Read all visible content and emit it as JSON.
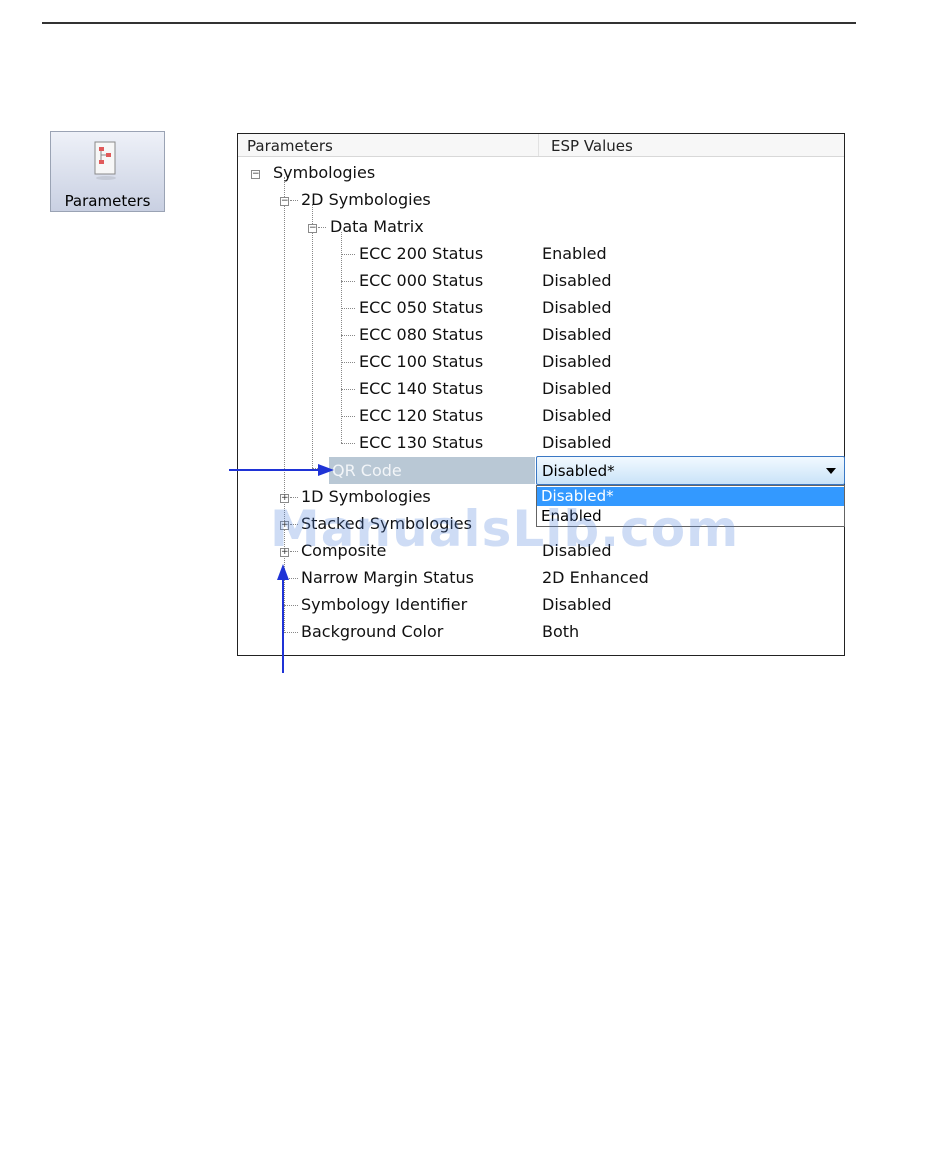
{
  "toolbar": {
    "parameters_button_label": "Parameters",
    "icon": "document-settings-icon"
  },
  "grid": {
    "columns": [
      "Parameters",
      "ESP Values"
    ],
    "rows": [
      {
        "label": "Symbologies",
        "value": "",
        "expander": "minus"
      },
      {
        "label": "2D Symbologies",
        "value": "",
        "expander": "minus"
      },
      {
        "label": "Data Matrix",
        "value": "",
        "expander": "minus"
      },
      {
        "label": "ECC 200 Status",
        "value": "Enabled"
      },
      {
        "label": "ECC 000 Status",
        "value": "Disabled"
      },
      {
        "label": "ECC 050 Status",
        "value": "Disabled"
      },
      {
        "label": "ECC 080 Status",
        "value": "Disabled"
      },
      {
        "label": "ECC 100 Status",
        "value": "Disabled"
      },
      {
        "label": "ECC 140 Status",
        "value": "Disabled"
      },
      {
        "label": "ECC 120 Status",
        "value": "Disabled"
      },
      {
        "label": "ECC 130 Status",
        "value": "Disabled"
      },
      {
        "label": "QR Code",
        "value": "Disabled*",
        "selected": true
      },
      {
        "label": "1D Symbologies",
        "value": "",
        "expander": "plus"
      },
      {
        "label": "Stacked Symbologies",
        "value": "",
        "expander": "plus"
      },
      {
        "label": "Composite",
        "value": "Disabled",
        "expander": "plus"
      },
      {
        "label": "Narrow Margin Status",
        "value": "2D Enhanced"
      },
      {
        "label": "Symbology Identifier",
        "value": "Disabled"
      },
      {
        "label": "Background Color",
        "value": "Both"
      }
    ],
    "dropdown": {
      "current": "Disabled*",
      "options": [
        "Disabled*",
        "Enabled"
      ],
      "highlighted_index": 0
    }
  },
  "watermark": "ManualsLib.com",
  "colors": {
    "annotation_arrow": "#1f33d6",
    "selection": "#3399ff",
    "selected_row": "#b9c8d5"
  }
}
